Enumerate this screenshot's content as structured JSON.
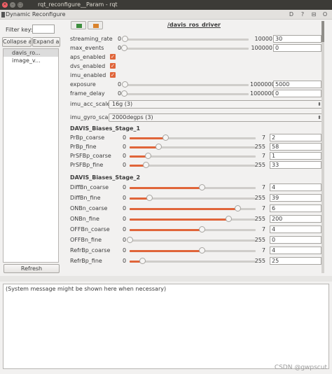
{
  "window": {
    "title": "rqt_reconfigure__Param - rqt",
    "close_glyph": "✕",
    "min_glyph": "–",
    "max_glyph": "□"
  },
  "dock": {
    "title": "Dynamic Reconfigure",
    "help": "D",
    "undock": "?",
    "restore": "⊟",
    "close": "O"
  },
  "left": {
    "filter_label": "Filter key:",
    "filter_value": "",
    "collapse_label": "Collapse all",
    "expand_label": "Expand all",
    "tree": [
      "davis_ro...",
      "image_v..."
    ],
    "refresh_label": "Refresh"
  },
  "main": {
    "node_title": "/davis_ros_driver",
    "params": [
      {
        "label": "streaming_rate",
        "min": "0",
        "max": "10000",
        "value": "30",
        "level": 0.003
      },
      {
        "label": "max_events",
        "min": "0",
        "max": "100000",
        "value": "0",
        "level": 0
      }
    ],
    "checks": [
      {
        "label": "aps_enabled",
        "checked": "✓"
      },
      {
        "label": "dvs_enabled",
        "checked": "✓"
      },
      {
        "label": "imu_enabled",
        "checked": "✓"
      }
    ],
    "params2": [
      {
        "label": "exposure",
        "min": "0",
        "max": "1000000",
        "value": "5000",
        "level": 0.005
      },
      {
        "label": "frame_delay",
        "min": "0",
        "max": "1000000",
        "value": "0",
        "level": 0
      }
    ],
    "combos": [
      {
        "label": "imu_acc_scale",
        "value": "16g (3)"
      },
      {
        "label": "imu_gyro_scale",
        "value": "2000degps (3)"
      }
    ],
    "group1": {
      "title": "DAVIS_Biases_Stage_1",
      "rows": [
        {
          "label": "PrBp_coarse",
          "min": "0",
          "max": "7",
          "value": "2",
          "level": 0.2857
        },
        {
          "label": "PrBp_fine",
          "min": "0",
          "max": "255",
          "value": "58",
          "level": 0.2275
        },
        {
          "label": "PrSFBp_coarse",
          "min": "0",
          "max": "7",
          "value": "1",
          "level": 0.1429
        },
        {
          "label": "PrSFBp_fine",
          "min": "0",
          "max": "255",
          "value": "33",
          "level": 0.1294
        }
      ]
    },
    "group2": {
      "title": "DAVIS_Biases_Stage_2",
      "rows": [
        {
          "label": "DiffBn_coarse",
          "min": "0",
          "max": "7",
          "value": "4",
          "level": 0.5714
        },
        {
          "label": "DiffBn_fine",
          "min": "0",
          "max": "255",
          "value": "39",
          "level": 0.1529
        },
        {
          "label": "ONBn_coarse",
          "min": "0",
          "max": "7",
          "value": "6",
          "level": 0.8571
        },
        {
          "label": "ONBn_fine",
          "min": "0",
          "max": "255",
          "value": "200",
          "level": 0.7843
        },
        {
          "label": "OFFBn_coarse",
          "min": "0",
          "max": "7",
          "value": "4",
          "level": 0.5714
        },
        {
          "label": "OFFBn_fine",
          "min": "0",
          "max": "255",
          "value": "0",
          "level": 0
        },
        {
          "label": "RefrBp_coarse",
          "min": "0",
          "max": "7",
          "value": "4",
          "level": 0.5714
        },
        {
          "label": "RefrBp_fine",
          "min": "0",
          "max": "255",
          "value": "25",
          "level": 0.098
        }
      ]
    }
  },
  "message": "(System message might be shown here when necessary)",
  "watermark": "CSDN @gwpscut",
  "colors": {
    "accent": "#e0653a",
    "titlebar": "#3c3b37"
  }
}
